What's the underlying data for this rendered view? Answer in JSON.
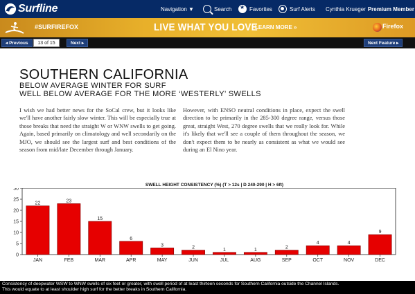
{
  "topnav": {
    "logo_text": "Surfline",
    "navigation_label": "Navigation ▼",
    "search_label": "Search",
    "favorites_label": "Favorites",
    "alerts_label": "Surf Alerts",
    "user_name": "Cynthia Krueger",
    "membership": "Premium Member"
  },
  "banner": {
    "hashtag": "#SURFIREFOX",
    "headline": "LIVE WHAT YOU LOVE",
    "cta": "LEARN MORE »",
    "brand": "Firefox"
  },
  "pager": {
    "previous_label": "◂ Previous",
    "counter": "13 of 15",
    "next_label": "Next ▸",
    "next_feature_label": "Next Feature ▸"
  },
  "article": {
    "title": "SOUTHERN CALIFORNIA",
    "subtitle_1": "BELOW AVERAGE WINTER FOR SURF",
    "subtitle_2": "WELL BELOW AVERAGE FOR THE MORE ‘WESTERLY’ SWELLS",
    "paragraph_left": "I wish we had better news for the SoCal crew, but it looks like we'll have another fairly slow winter. This will be especially true at those breaks that need the straight W or WNW swells to get going. Again, based primarily on climatology and well secondarily on the MJO, we should see the largest surf and best conditions of the season from mid/late December through January.",
    "paragraph_right": "However, with ENSO neutral conditions in place, expect the swell direction to be primarily in the 285-300 degree range, versus those great, straight West, 270 degree swells that we really look for. While it's likely that we'll see a couple of them throughout the season, we don't expect them to be nearly as consistent as what we would see during an El Nino year."
  },
  "chart_data": {
    "type": "bar",
    "title": "SWELL HEIGHT CONSISTENCY (%) (T > 12s | D 240-290 | H > 6ft)",
    "categories": [
      "JAN",
      "FEB",
      "MAR",
      "APR",
      "MAY",
      "JUN",
      "JUL",
      "AUG",
      "SEP",
      "OCT",
      "NOV",
      "DEC"
    ],
    "values": [
      22,
      23,
      15,
      6,
      3,
      2,
      1,
      1,
      2,
      4,
      4,
      9
    ],
    "ylim": [
      0,
      30
    ],
    "yticks": [
      0,
      5,
      10,
      15,
      20,
      25,
      30
    ],
    "bar_color": "#e60000",
    "grid": false,
    "xlabel": "",
    "ylabel": ""
  },
  "caption": {
    "line_1": "Consistency of deepwater WSW to WNW swells of six feet or greater, with swell period of at least thirteen seconds for Southern California outside the Channel Islands.",
    "line_2": "This would equate to at least shoulder high surf for the better breaks in Southern California."
  }
}
